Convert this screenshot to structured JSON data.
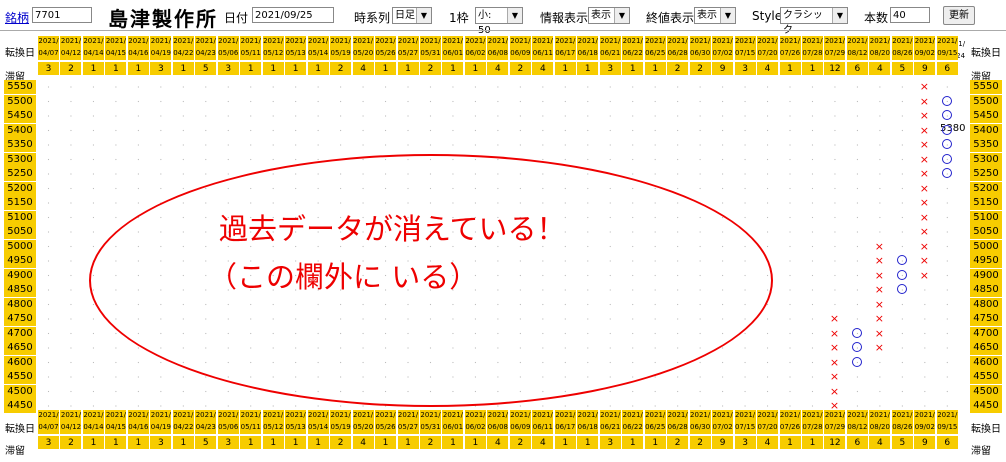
{
  "toolbar": {
    "code_label": "銘柄",
    "code_value": "7701",
    "company": "島津製作所",
    "date_label": "日付",
    "date_value": "2021/09/25",
    "timeseries_label": "時系列",
    "timeseries_value": "日足",
    "box_label": "1枠",
    "box_value": "小: 50",
    "info_label": "情報表示",
    "info_value": "表示",
    "close_label": "終値表示",
    "close_value": "表示",
    "style_label": "Style",
    "style_value": "クラシック",
    "count_label": "本数",
    "count_value": "40",
    "refresh_label": "更新"
  },
  "chart": {
    "row_label_date": "転換日",
    "row_label_stay": "滞留",
    "columns": [
      {
        "y": "2021/",
        "d": "04/07",
        "s": "3"
      },
      {
        "y": "2021/",
        "d": "04/12",
        "s": "2"
      },
      {
        "y": "2021/",
        "d": "04/14",
        "s": "1"
      },
      {
        "y": "2021/",
        "d": "04/15",
        "s": "1"
      },
      {
        "y": "2021/",
        "d": "04/16",
        "s": "1"
      },
      {
        "y": "2021/",
        "d": "04/19",
        "s": "3"
      },
      {
        "y": "2021/",
        "d": "04/22",
        "s": "1"
      },
      {
        "y": "2021/",
        "d": "04/23",
        "s": "5"
      },
      {
        "y": "2021/",
        "d": "05/06",
        "s": "3"
      },
      {
        "y": "2021/",
        "d": "05/11",
        "s": "1"
      },
      {
        "y": "2021/",
        "d": "05/12",
        "s": "1"
      },
      {
        "y": "2021/",
        "d": "05/13",
        "s": "1"
      },
      {
        "y": "2021/",
        "d": "05/14",
        "s": "1"
      },
      {
        "y": "2021/",
        "d": "05/19",
        "s": "2"
      },
      {
        "y": "2021/",
        "d": "05/20",
        "s": "4"
      },
      {
        "y": "2021/",
        "d": "05/26",
        "s": "1"
      },
      {
        "y": "2021/",
        "d": "05/27",
        "s": "1"
      },
      {
        "y": "2021/",
        "d": "05/31",
        "s": "2"
      },
      {
        "y": "2021/",
        "d": "06/01",
        "s": "1"
      },
      {
        "y": "2021/",
        "d": "06/02",
        "s": "1"
      },
      {
        "y": "2021/",
        "d": "06/08",
        "s": "4"
      },
      {
        "y": "2021/",
        "d": "06/09",
        "s": "2"
      },
      {
        "y": "2021/",
        "d": "06/11",
        "s": "4"
      },
      {
        "y": "2021/",
        "d": "06/17",
        "s": "1"
      },
      {
        "y": "2021/",
        "d": "06/18",
        "s": "1"
      },
      {
        "y": "2021/",
        "d": "06/21",
        "s": "3"
      },
      {
        "y": "2021/",
        "d": "06/22",
        "s": "1"
      },
      {
        "y": "2021/",
        "d": "06/25",
        "s": "1"
      },
      {
        "y": "2021/",
        "d": "06/28",
        "s": "2"
      },
      {
        "y": "2021/",
        "d": "06/30",
        "s": "2"
      },
      {
        "y": "2021/",
        "d": "07/02",
        "s": "9"
      },
      {
        "y": "2021/",
        "d": "07/15",
        "s": "3"
      },
      {
        "y": "2021/",
        "d": "07/20",
        "s": "4"
      },
      {
        "y": "2021/",
        "d": "07/26",
        "s": "1"
      },
      {
        "y": "2021/",
        "d": "07/28",
        "s": "1"
      },
      {
        "y": "2021/",
        "d": "07/29",
        "s": "12"
      },
      {
        "y": "2021/",
        "d": "08/12",
        "s": "6"
      },
      {
        "y": "2021/",
        "d": "08/20",
        "s": "4"
      },
      {
        "y": "2021/",
        "d": "08/26",
        "s": "5"
      },
      {
        "y": "2021/",
        "d": "09/02",
        "s": "9"
      },
      {
        "y": "2021/",
        "d": "09/15",
        "s": "6"
      }
    ],
    "extra_date": {
      "y": "2021/",
      "d": "09/24"
    },
    "price_levels": [
      5550,
      5500,
      5450,
      5400,
      5350,
      5300,
      5250,
      5200,
      5150,
      5100,
      5050,
      5000,
      4950,
      4900,
      4850,
      4800,
      4750,
      4700,
      4650,
      4600,
      4550,
      4500,
      4450
    ],
    "marks": [
      {
        "col": 35,
        "type": "x",
        "from": 4450,
        "to": 4750
      },
      {
        "col": 36,
        "type": "o",
        "from": 4600,
        "to": 4700
      },
      {
        "col": 37,
        "type": "x",
        "from": 4650,
        "to": 5000
      },
      {
        "col": 38,
        "type": "o",
        "from": 4850,
        "to": 4950
      },
      {
        "col": 39,
        "type": "x",
        "from": 4900,
        "to": 5550
      },
      {
        "col": 40,
        "type": "o",
        "from": 5250,
        "to": 5500
      }
    ],
    "last_close": "5380",
    "colors": {
      "header": "#f7cc00",
      "x": "#e00000",
      "o": "#2222cc",
      "annotation": "#e00000"
    }
  },
  "annotation": {
    "line1": "過去データが消えている！",
    "line2": "（この欄外に いる）"
  }
}
